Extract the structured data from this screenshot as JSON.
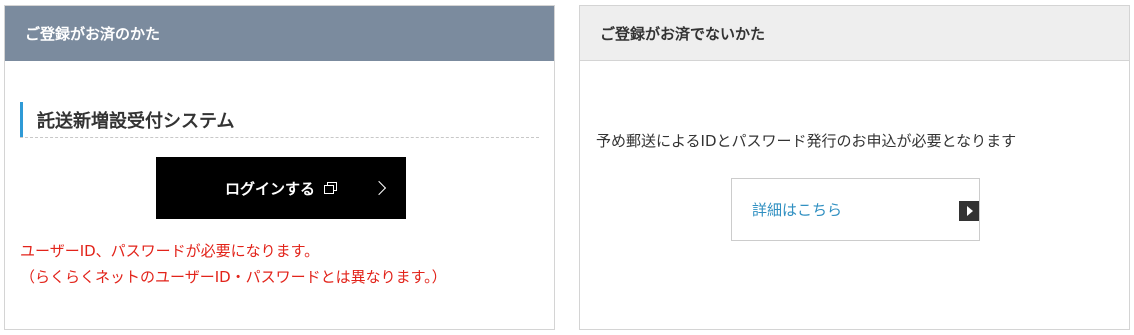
{
  "left_panel": {
    "header": "ご登録がお済のかた",
    "section_title": "託送新増設受付システム",
    "login_button_label": "ログインする",
    "note_line1": "ユーザーID、パスワードが必要になります。",
    "note_line2": "（らくらくネットのユーザーID・パスワードとは異なります。）",
    "colors": {
      "header_bg": "#7b8b9e",
      "accent": "#2f9ad6",
      "note": "#e2231a"
    },
    "icons": [
      "window-icon",
      "chevron-right-icon"
    ]
  },
  "right_panel": {
    "header": "ご登録がお済でないかた",
    "description": "予め郵送によるIDとパスワード発行のお申込が必要となります",
    "detail_link_label": "詳細はこちら",
    "colors": {
      "header_bg": "#eeeeee",
      "link": "#2f8fc1"
    },
    "icons": [
      "arrow-box-icon"
    ]
  }
}
